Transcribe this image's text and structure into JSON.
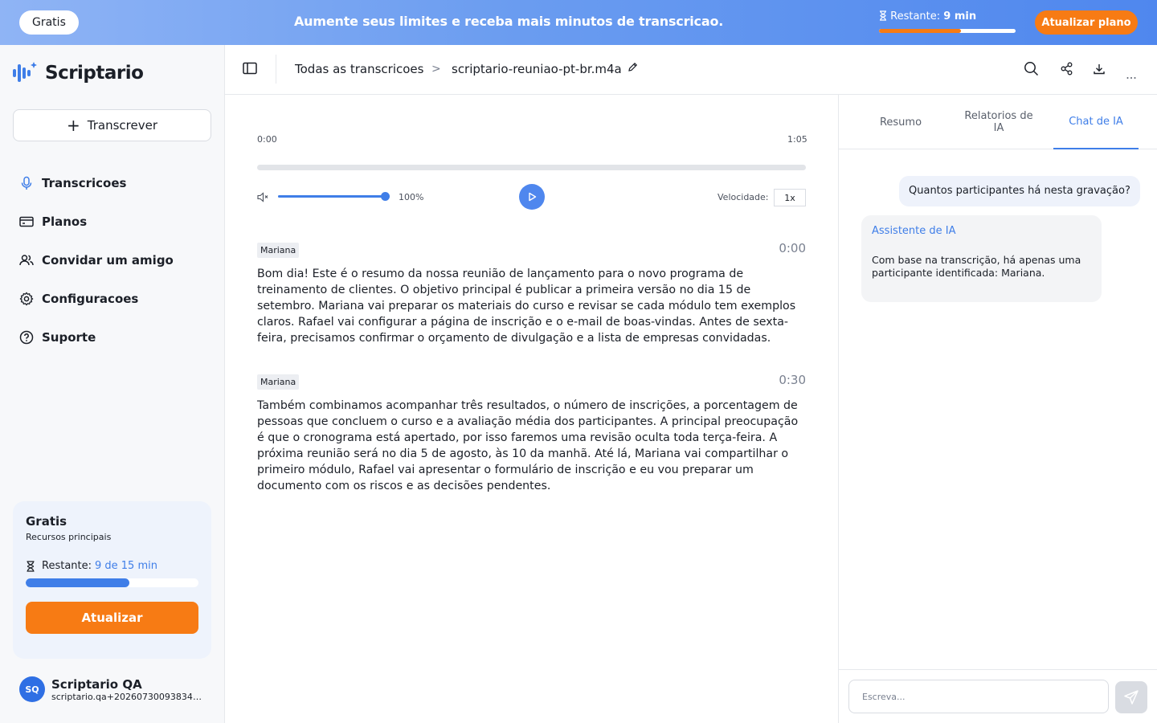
{
  "banner": {
    "plan_badge": "Gratis",
    "message": "Aumente seus limites e receba mais minutos de transcricao.",
    "remaining_label": "Restante:",
    "remaining_value": "9 min",
    "remaining_fraction": 0.6,
    "upgrade_label": "Atualizar plano",
    "accent_color": "#f77b14"
  },
  "sidebar": {
    "brand": "Scriptario",
    "transcribe_label": "Transcrever",
    "items": [
      {
        "label": "Transcricoes",
        "icon": "microphone-icon"
      },
      {
        "label": "Planos",
        "icon": "card-icon"
      },
      {
        "label": "Convidar um amigo",
        "icon": "users-icon"
      },
      {
        "label": "Configuracoes",
        "icon": "gear-icon"
      },
      {
        "label": "Suporte",
        "icon": "help-icon"
      }
    ],
    "plan": {
      "title": "Gratis",
      "subtitle": "Recursos principais",
      "remaining_label": "Restante:",
      "remaining_value": "9 de 15 min",
      "remaining_fraction": 0.6,
      "update_label": "Atualizar"
    },
    "user": {
      "initials": "SQ",
      "name": "Scriptario QA",
      "email": "scriptario.qa+20260730093834@..."
    }
  },
  "header": {
    "breadcrumb_root": "Todas as transcricoes",
    "separator": ">",
    "file_name": "scriptario-reuniao-pt-br.m4a"
  },
  "player": {
    "current_time": "0:00",
    "duration": "1:05",
    "progress_fraction": 0.0,
    "volume_fraction": 1.0,
    "volume_label": "100%",
    "speed_label": "Velocidade:",
    "speed_value": "1x"
  },
  "transcript": [
    {
      "speaker": "Mariana",
      "time": "0:00",
      "text": "Bom dia! Este é o resumo da nossa reunião de lançamento para o novo programa de treinamento de clientes. O objetivo principal é publicar a primeira versão no dia 15 de setembro. Mariana vai preparar os materiais do curso e revisar se cada módulo tem exemplos claros. Rafael vai configurar a página de inscrição e o e-mail de boas-vindas. Antes de sexta-feira, precisamos confirmar o orçamento de divulgação e a lista de empresas convidadas."
    },
    {
      "speaker": "Mariana",
      "time": "0:30",
      "text": "Também combinamos acompanhar três resultados, o número de inscrições, a porcentagem de pessoas que concluem o curso e a avaliação média dos participantes. A principal preocupação é que o cronograma está apertado, por isso faremos uma revisão oculta toda terça-feira. A próxima reunião será no dia 5 de agosto, às 10 da manhã. Até lá, Mariana vai compartilhar o primeiro módulo, Rafael vai apresentar o formulário de inscrição e eu vou preparar um documento com os riscos e as decisões pendentes."
    }
  ],
  "panel": {
    "tabs": [
      "Resumo",
      "Relatorios de IA",
      "Chat de IA"
    ],
    "active_tab": 2,
    "user_message": "Quantos participantes há nesta gravação?",
    "assistant_name": "Assistente de IA",
    "assistant_message": "Com base na transcrição, há apenas uma participante identificada: Mariana.",
    "input_placeholder": "Escreva..."
  }
}
